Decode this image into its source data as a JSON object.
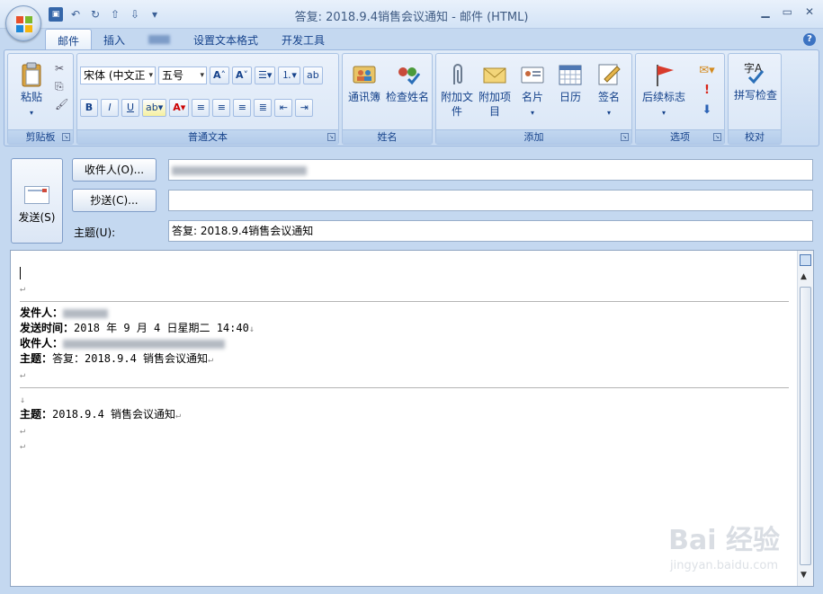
{
  "window": {
    "title": "答复: 2018.9.4销售会议通知 - 邮件 (HTML)"
  },
  "tabs": [
    "邮件",
    "插入",
    "",
    "设置文本格式",
    "开发工具"
  ],
  "ribbon": {
    "clipboard": {
      "label": "剪贴板",
      "paste": "粘贴"
    },
    "text": {
      "label": "普通文本",
      "font": "宋体 (中文正",
      "size": "五号"
    },
    "names": {
      "label": "姓名",
      "address_book": "通讯簿",
      "check_names": "检查姓名"
    },
    "include": {
      "label": "添加",
      "attach_file": "附加文件",
      "attach_item": "附加项目",
      "business_card": "名片",
      "calendar": "日历",
      "signature": "签名"
    },
    "options": {
      "label": "选项",
      "follow_up": "后续标志"
    },
    "proofing": {
      "label": "校对",
      "spelling": "拼写检查"
    }
  },
  "header": {
    "send": "发送(S)",
    "to_button": "收件人(O)...",
    "cc_button": "抄送(C)...",
    "subject_label": "主题(U):",
    "subject_value": "答复: 2018.9.4销售会议通知"
  },
  "body": {
    "from_label": "发件人：",
    "sent_label": "发送时间：",
    "to_label": "收件人：",
    "subject_label": "主题：",
    "sent_value": "2018 年 9 月 4 日星期二 14:40",
    "subject1": "答复：2018.9.4 销售会议通知",
    "subject2": "2018.9.4 销售会议通知"
  },
  "watermark": {
    "brand": "Bai 经验",
    "url": "jingyan.baidu.com"
  }
}
